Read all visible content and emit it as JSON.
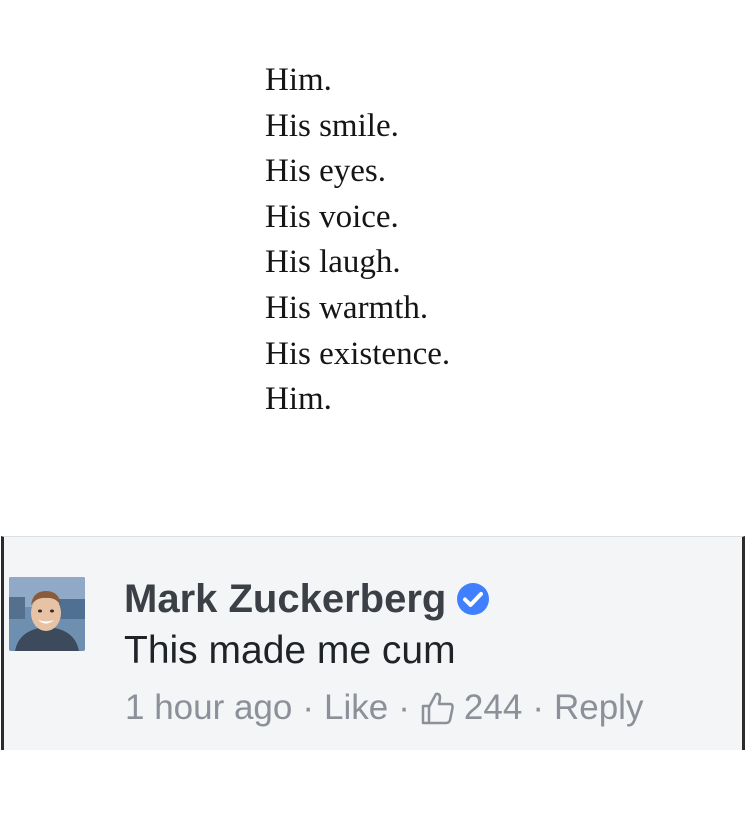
{
  "poem": {
    "lines": [
      "Him.",
      "His smile.",
      "His eyes.",
      "His voice.",
      "His laugh.",
      "His warmth.",
      "His existence.",
      "Him."
    ]
  },
  "comment": {
    "author": "Mark Zuckerberg",
    "verified_icon": "verified-badge-icon",
    "text": "This made me cum",
    "timestamp": "1 hour ago",
    "separator": "·",
    "like_label": "Like",
    "like_icon": "thumbs-up-icon",
    "like_count": "244",
    "reply_label": "Reply",
    "accent_color": "#4080ff"
  }
}
